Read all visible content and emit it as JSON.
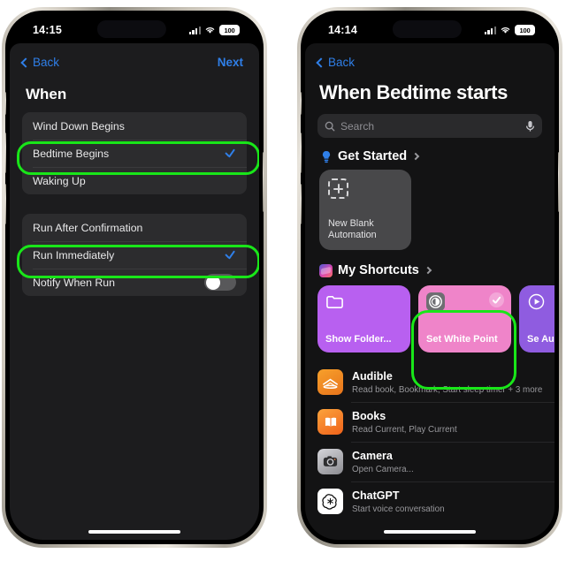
{
  "left_phone": {
    "status_bar": {
      "time": "14:15",
      "battery": "100",
      "signal_icon": "cellular-signal-icon",
      "wifi_icon": "wifi-icon",
      "battery_icon": "battery-icon"
    },
    "nav": {
      "back_label": "Back",
      "next_label": "Next",
      "back_icon": "chevron-left-icon"
    },
    "title": "When",
    "group_trigger": {
      "rows": [
        {
          "label": "Wind Down Begins",
          "selected": false,
          "highlighted": false
        },
        {
          "label": "Bedtime Begins",
          "selected": true,
          "highlighted": true
        },
        {
          "label": "Waking Up",
          "selected": false,
          "highlighted": false
        }
      ]
    },
    "group_run": {
      "rows": [
        {
          "label": "Run After Confirmation",
          "selected": false,
          "highlighted": false
        },
        {
          "label": "Run Immediately",
          "selected": true,
          "highlighted": true
        },
        {
          "label": "Notify When Run",
          "toggle": true,
          "toggle_on": false
        }
      ]
    }
  },
  "right_phone": {
    "status_bar": {
      "time": "14:14",
      "battery": "100"
    },
    "nav": {
      "back_label": "Back"
    },
    "title": "When Bedtime starts",
    "search": {
      "placeholder": "Search",
      "search_icon": "search-icon",
      "mic_icon": "microphone-icon"
    },
    "get_started": {
      "label": "Get Started",
      "icon": "lightbulb-icon",
      "chevron": "chevron-right-icon"
    },
    "blank_card": {
      "line1": "New Blank",
      "line2": "Automation",
      "icon": "dashed-plus-icon"
    },
    "my_shortcuts": {
      "label": "My Shortcuts",
      "icon": "shortcuts-app-icon",
      "chevron": "chevron-right-icon"
    },
    "shortcut_cards": [
      {
        "title": "Show Folder...",
        "color": "#b860f0",
        "icon": "folder-icon",
        "selected": false,
        "highlighted": false
      },
      {
        "title": "Set White Point",
        "color": "#ef84c9",
        "icon": "accessibility-icon",
        "selected": true,
        "highlighted": true
      },
      {
        "title": "Se Au (S",
        "color": "#8f5ce0",
        "icon": "play-circle-icon",
        "selected": false,
        "highlighted": false
      }
    ],
    "apps": [
      {
        "name": "Audible",
        "subtitle": "Read book, Bookmark, Start sleep timer + 3 more",
        "icon": "audible-icon",
        "color": "#f5a623"
      },
      {
        "name": "Books",
        "subtitle": "Read Current, Play Current",
        "icon": "books-icon",
        "color": "#f4851f"
      },
      {
        "name": "Camera",
        "subtitle": "Open Camera...",
        "icon": "camera-icon",
        "color": "#8a8a8e"
      },
      {
        "name": "ChatGPT",
        "subtitle": "Start voice conversation",
        "icon": "chatgpt-icon",
        "color": "#ffffff"
      }
    ]
  },
  "theme": {
    "accent_blue": "#2f7fe8",
    "highlight_green": "#19e619",
    "sheet_bg": "#1c1c1e",
    "row_bg": "#2c2c2e"
  }
}
